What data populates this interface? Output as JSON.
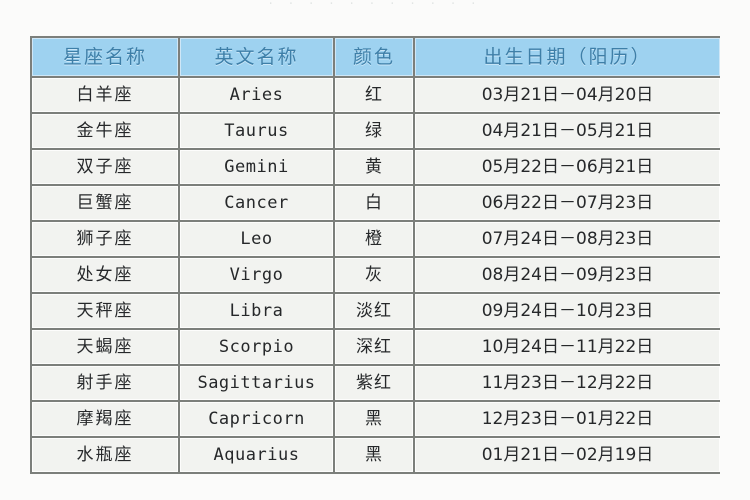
{
  "page": {
    "top_remnant_text": "· · · · ·    · ·    · · · ·",
    "header_bg": "#9ed2f0",
    "header_text_color": "#3e7fa8",
    "cell_bg": "#f2f3f0",
    "cell_text_color": "#26282a",
    "border_color": "#7c7f7b",
    "page_bg": "#fbfbfa"
  },
  "table": {
    "columns": [
      {
        "key": "cn_name",
        "label": "星座名称"
      },
      {
        "key": "en_name",
        "label": "英文名称"
      },
      {
        "key": "color",
        "label": "颜色"
      },
      {
        "key": "date",
        "label": "出生日期（阳历）"
      }
    ],
    "rows": [
      {
        "cn_name": "白羊座",
        "en_name": "Aries",
        "color": "红",
        "date": "03月21日－04月20日"
      },
      {
        "cn_name": "金牛座",
        "en_name": "Taurus",
        "color": "绿",
        "date": "04月21日－05月21日"
      },
      {
        "cn_name": "双子座",
        "en_name": "Gemini",
        "color": "黄",
        "date": "05月22日－06月21日"
      },
      {
        "cn_name": "巨蟹座",
        "en_name": "Cancer",
        "color": "白",
        "date": "06月22日－07月23日"
      },
      {
        "cn_name": "狮子座",
        "en_name": "Leo",
        "color": "橙",
        "date": "07月24日－08月23日"
      },
      {
        "cn_name": "处女座",
        "en_name": "Virgo",
        "color": "灰",
        "date": "08月24日－09月23日"
      },
      {
        "cn_name": "天秤座",
        "en_name": "Libra",
        "color": "淡红",
        "date": "09月24日－10月23日"
      },
      {
        "cn_name": "天蝎座",
        "en_name": "Scorpio",
        "color": "深红",
        "date": "10月24日－11月22日"
      },
      {
        "cn_name": "射手座",
        "en_name": "Sagittarius",
        "color": "紫红",
        "date": "11月23日－12月22日"
      },
      {
        "cn_name": "摩羯座",
        "en_name": "Capricorn",
        "color": "黑",
        "date": "12月23日－01月22日"
      },
      {
        "cn_name": "水瓶座",
        "en_name": "Aquarius",
        "color": "黑",
        "date": "01月21日－02月19日"
      }
    ]
  }
}
